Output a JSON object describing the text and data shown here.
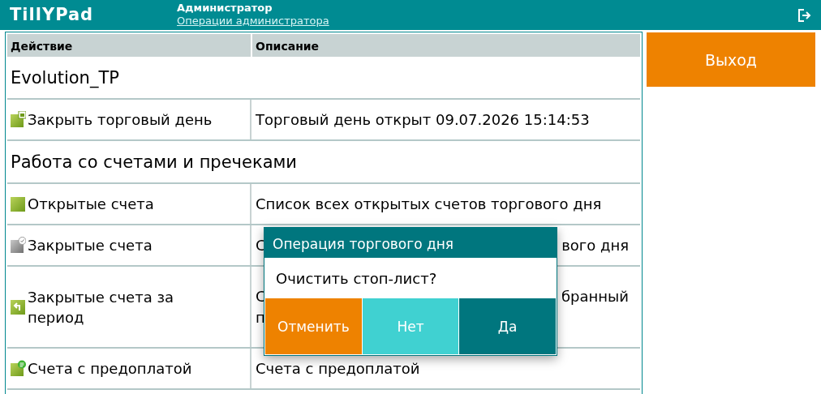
{
  "header": {
    "logo": "TillYPad",
    "user": "Администратор",
    "subtitle": "Операции администратора"
  },
  "table": {
    "columns": [
      "Действие",
      "Описание"
    ],
    "rows": [
      {
        "kind": "group",
        "title": "Evolution_TP"
      },
      {
        "kind": "item",
        "action": "Закрыть торговый день",
        "description_lines": [
          [
            "Торговый день открыт 09.07.2026 15:14:53"
          ]
        ]
      },
      {
        "kind": "group",
        "title": "Работа со счетами и пречеками"
      },
      {
        "kind": "item",
        "action": "Открытые счета",
        "description_lines": [
          [
            "Список всех открытых счетов торгового дня"
          ]
        ]
      },
      {
        "kind": "item",
        "action": "Закрытые счета",
        "description_lines": [
          [
            "С",
            "вого дня"
          ]
        ]
      },
      {
        "kind": "item",
        "action": "Закрытые счета за период",
        "description_lines": [
          [
            "С",
            "бранный"
          ],
          [
            "п"
          ]
        ]
      },
      {
        "kind": "item",
        "action": "Счета с предоплатой",
        "description_lines": [
          [
            "Счета с предоплатой"
          ]
        ]
      }
    ]
  },
  "exit_button": "Выход",
  "dialog": {
    "title": "Операция торгового дня",
    "message": "Очистить стоп-лист?",
    "buttons": [
      {
        "kind": "cancel",
        "label": "Отменить"
      },
      {
        "kind": "no",
        "label": "Нет"
      },
      {
        "kind": "yes",
        "label": "Да"
      }
    ]
  }
}
